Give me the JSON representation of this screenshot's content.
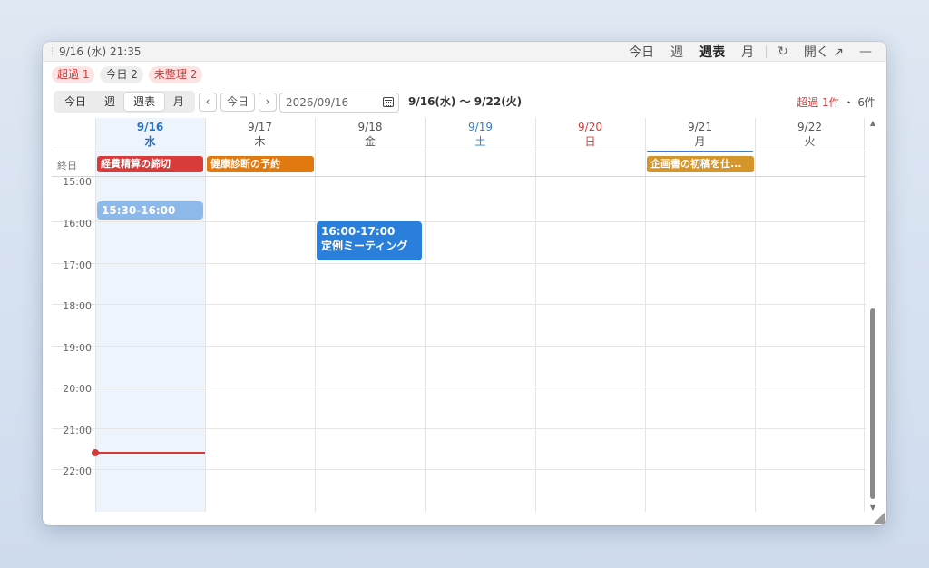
{
  "titlebar": {
    "title": "9/16 (水) 21:35",
    "view_today": "今日",
    "view_week": "週",
    "view_weekgrid": "週表",
    "view_month": "月",
    "refresh_icon": "↻",
    "open_label": "開く",
    "open_icon": "↗",
    "minimize_icon": "—"
  },
  "badges": {
    "overdue": "超過 1",
    "today": "今日 2",
    "unsorted": "未整理 2"
  },
  "toolbar": {
    "seg_today": "今日",
    "seg_week": "週",
    "seg_weekgrid": "週表",
    "seg_month": "月",
    "prev_icon": "‹",
    "today_button": "今日",
    "next_icon": "›",
    "date_value": "2026/09/16",
    "range_label": "9/16(水) 〜 9/22(火)",
    "summary_overdue": "超過 1件",
    "summary_sep": "・",
    "summary_total": "6件"
  },
  "days": [
    {
      "date": "9/16",
      "weekday": "水"
    },
    {
      "date": "9/17",
      "weekday": "木"
    },
    {
      "date": "9/18",
      "weekday": "金"
    },
    {
      "date": "9/19",
      "weekday": "土"
    },
    {
      "date": "9/20",
      "weekday": "日"
    },
    {
      "date": "9/21",
      "weekday": "月"
    },
    {
      "date": "9/22",
      "weekday": "火"
    }
  ],
  "allday_label": "終日",
  "allday_events": [
    {
      "title": "経費精算の締切",
      "color": "#d93b3b"
    },
    {
      "title": "健康診断の予約",
      "color": "#e07a10"
    },
    {
      "title": "企画書の初稿を仕...",
      "color": "#d4962a"
    }
  ],
  "hours": [
    "15:00",
    "16:00",
    "17:00",
    "18:00",
    "19:00",
    "20:00",
    "21:00",
    "22:00"
  ],
  "events": [
    {
      "time": "15:30-16:00",
      "title": "",
      "color": "#8cb8ea"
    },
    {
      "time": "16:00-17:00",
      "title": "定例ミーティング",
      "color": "#2a7fdb"
    }
  ],
  "colors": {
    "accent": "#2a6fc4",
    "overdue": "#d23a3a",
    "now_line": "#d23a3a"
  }
}
